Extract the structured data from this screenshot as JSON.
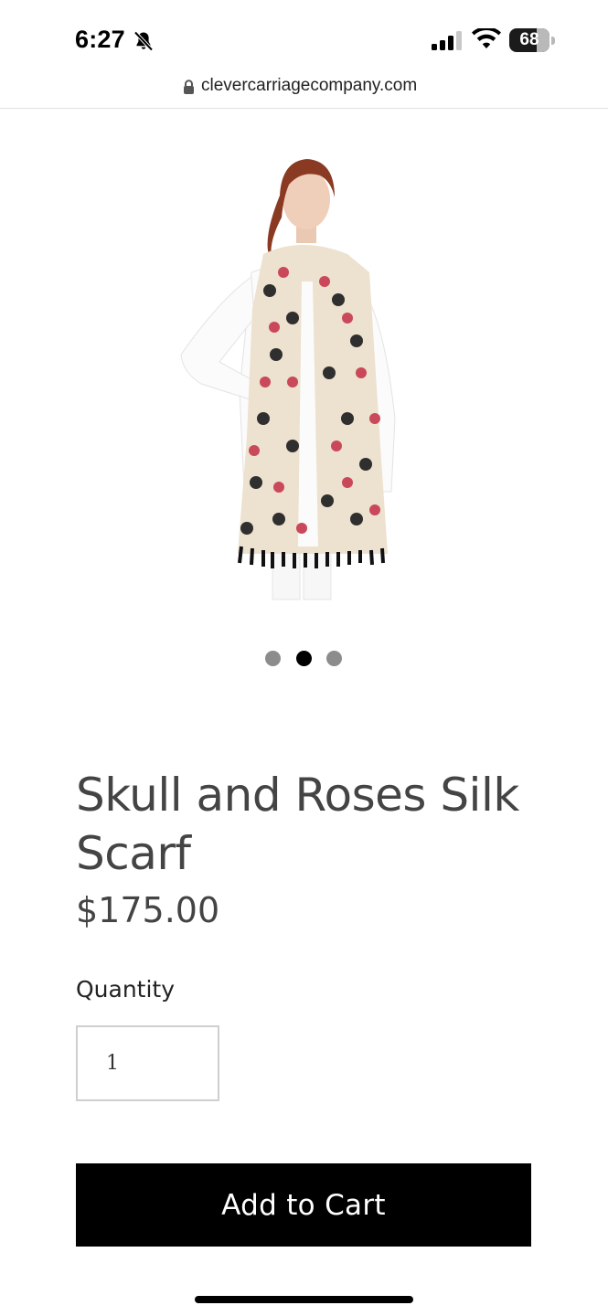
{
  "status_bar": {
    "time": "6:27",
    "battery_level": "68"
  },
  "browser": {
    "url": "clevercarriagecompany.com"
  },
  "product": {
    "title": "Skull and Roses Silk Scarf",
    "price": "$175.00",
    "image_alt": "Skull and Roses Silk Scarf",
    "quantity_label": "Quantity",
    "quantity_value": "1",
    "add_to_cart_label": "Add to Cart"
  },
  "carousel": {
    "total_slides": 3,
    "active_index": 1
  },
  "colors": {
    "title_text": "#444444",
    "button_bg": "#000000",
    "button_text": "#ffffff",
    "dot_inactive": "#8c8c8c",
    "dot_active": "#000000"
  }
}
